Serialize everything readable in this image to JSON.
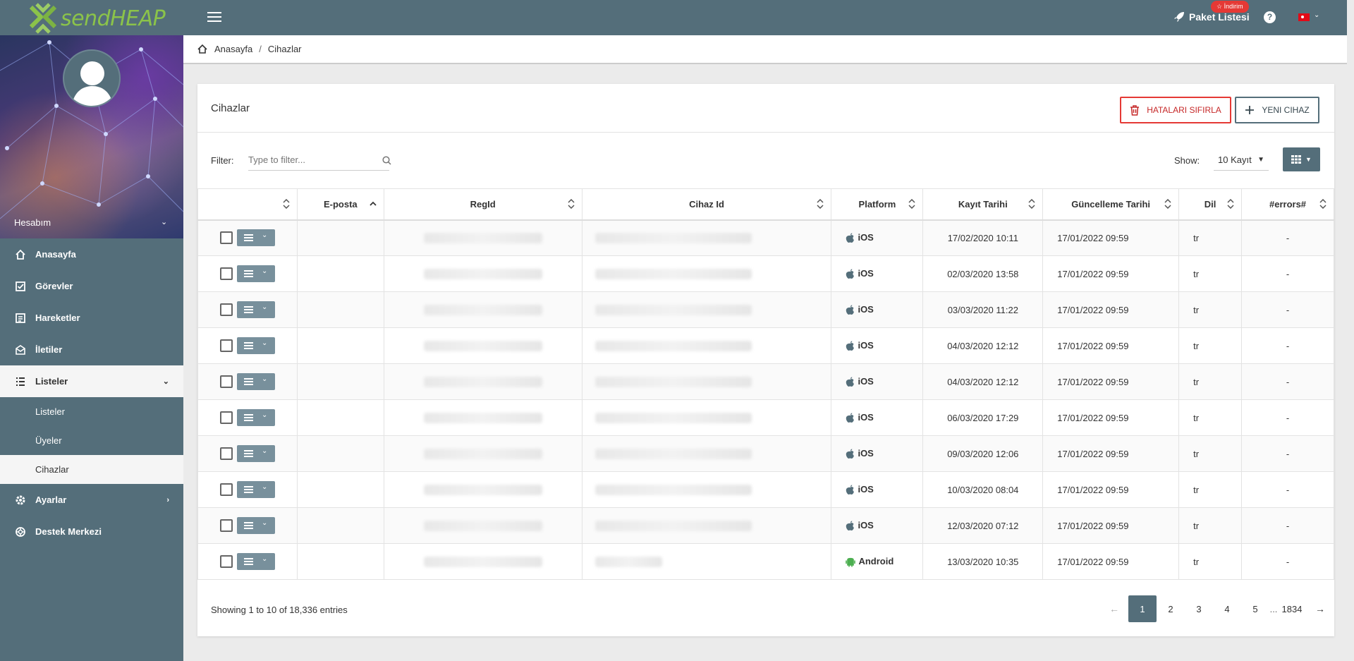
{
  "brand": {
    "logo_text": "sendHEAP",
    "accent": "#8bc34a",
    "header_bg": "#546e7a"
  },
  "topbar": {
    "package_label": "Paket Listesi",
    "discount_badge": "☆ İndirim",
    "help_icon": "question-circle-icon",
    "language": "tr-flag"
  },
  "sidebar": {
    "account_label": "Hesabım",
    "items": [
      {
        "label": "Anasayfa",
        "icon": "home-icon"
      },
      {
        "label": "Görevler",
        "icon": "checkbox-icon"
      },
      {
        "label": "Hareketler",
        "icon": "list-doc-icon"
      },
      {
        "label": "İletiler",
        "icon": "mail-icon"
      },
      {
        "label": "Listeler",
        "icon": "list-icon"
      },
      {
        "label": "Ayarlar",
        "icon": "gear-icon"
      },
      {
        "label": "Destek Merkezi",
        "icon": "lifebuoy-icon"
      }
    ],
    "sub_items": [
      "Listeler",
      "Üyeler",
      "Cihazlar"
    ]
  },
  "breadcrumb": {
    "home": "Anasayfa",
    "current": "Cihazlar",
    "separator": "/"
  },
  "card": {
    "title": "Cihazlar",
    "reset_button": "HATALARI SIFIRLA",
    "new_button": "YENI CIHAZ",
    "filter_label": "Filter:",
    "filter_placeholder": "Type to filter...",
    "show_label": "Show:",
    "show_value": "10 Kayıt"
  },
  "table": {
    "columns": [
      "",
      "E-posta",
      "RegId",
      "Cihaz Id",
      "Platform",
      "Kayıt Tarihi",
      "Güncelleme Tarihi",
      "Dil",
      "#errors#"
    ],
    "rows": [
      {
        "email": "",
        "platform": "iOS",
        "created": "17/02/2020 10:11",
        "updated": "17/01/2022 09:59",
        "lang": "tr",
        "errors": "-"
      },
      {
        "email": "",
        "platform": "iOS",
        "created": "02/03/2020 13:58",
        "updated": "17/01/2022 09:59",
        "lang": "tr",
        "errors": "-"
      },
      {
        "email": "",
        "platform": "iOS",
        "created": "03/03/2020 11:22",
        "updated": "17/01/2022 09:59",
        "lang": "tr",
        "errors": "-"
      },
      {
        "email": "",
        "platform": "iOS",
        "created": "04/03/2020 12:12",
        "updated": "17/01/2022 09:59",
        "lang": "tr",
        "errors": "-"
      },
      {
        "email": "",
        "platform": "iOS",
        "created": "04/03/2020 12:12",
        "updated": "17/01/2022 09:59",
        "lang": "tr",
        "errors": "-"
      },
      {
        "email": "",
        "platform": "iOS",
        "created": "06/03/2020 17:29",
        "updated": "17/01/2022 09:59",
        "lang": "tr",
        "errors": "-"
      },
      {
        "email": "",
        "platform": "iOS",
        "created": "09/03/2020 12:06",
        "updated": "17/01/2022 09:59",
        "lang": "tr",
        "errors": "-"
      },
      {
        "email": "",
        "platform": "iOS",
        "created": "10/03/2020 08:04",
        "updated": "17/01/2022 09:59",
        "lang": "tr",
        "errors": "-"
      },
      {
        "email": "",
        "platform": "iOS",
        "created": "12/03/2020 07:12",
        "updated": "17/01/2022 09:59",
        "lang": "tr",
        "errors": "-"
      },
      {
        "email": "",
        "platform": "Android",
        "created": "13/03/2020 10:35",
        "updated": "17/01/2022 09:59",
        "lang": "tr",
        "errors": "-"
      }
    ]
  },
  "footer": {
    "showing": "Showing 1 to 10 of 18,336 entries",
    "pages": [
      "1",
      "2",
      "3",
      "4",
      "5"
    ],
    "ellipsis": "...",
    "last_page": "1834",
    "prev": "←",
    "next": "→",
    "current_page": "1"
  }
}
